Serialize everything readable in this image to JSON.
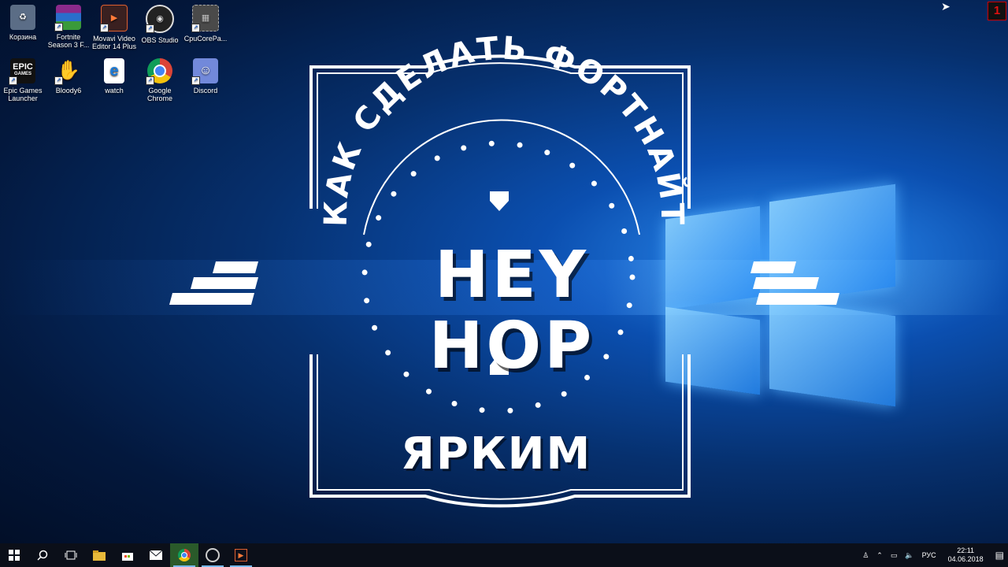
{
  "desktop_icons": [
    {
      "label": "Корзина",
      "icon": "recycle-bin-icon"
    },
    {
      "label": "Fortnite Season 3 F...",
      "icon": "winrar-archive-icon"
    },
    {
      "label": "Movavi Video Editor 14 Plus",
      "icon": "movavi-icon"
    },
    {
      "label": "OBS Studio",
      "icon": "obs-icon"
    },
    {
      "label": "CpuCorePa...",
      "icon": "cpu-chip-icon"
    },
    {
      "label": "Epic Games Launcher",
      "icon": "epic-games-icon"
    },
    {
      "label": "Bloody6",
      "icon": "bloody-hand-icon"
    },
    {
      "label": "watch",
      "icon": "edge-file-icon"
    },
    {
      "label": "Google Chrome",
      "icon": "chrome-icon"
    },
    {
      "label": "Discord",
      "icon": "discord-icon"
    }
  ],
  "thumbnail": {
    "arc_text": "КАК СДЕЛАТЬ ФОРТНАЙТ",
    "main_text": "HEY HOP",
    "bottom_text": "ЯРКИМ",
    "epic_label": "EPIC",
    "epic_sub": "GAMES"
  },
  "taskbar": {
    "language": "РУС",
    "time": "22:11",
    "date": "04.06.2018",
    "badge": "1"
  }
}
